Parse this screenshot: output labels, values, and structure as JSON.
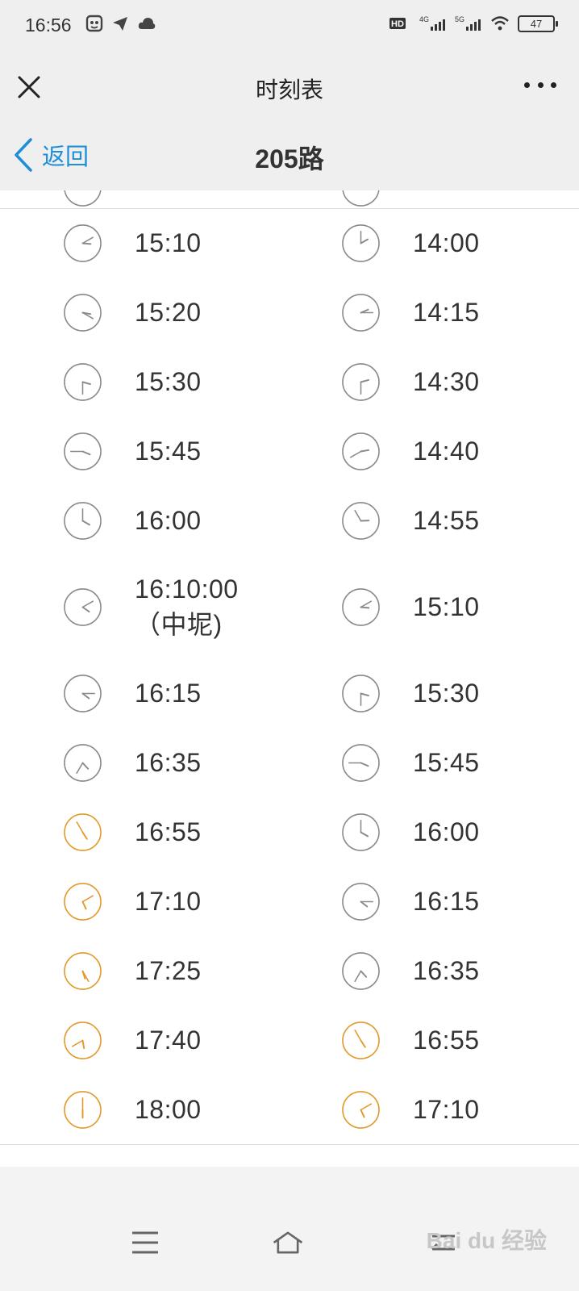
{
  "status_bar": {
    "time": "16:56",
    "network_1": "4G",
    "network_2": "5G",
    "hd_label": "HD",
    "battery": "47"
  },
  "top_bar": {
    "title": "时刻表"
  },
  "nav_bar": {
    "back_label": "返回",
    "route_title": "205路"
  },
  "colors": {
    "accent": "#1d8fd6",
    "clock_gray": "#8a8a8a",
    "clock_orange": "#e39a2b"
  },
  "timetable": {
    "rows": [
      {
        "left": {
          "time": "15:10",
          "sub": "",
          "color": "gray"
        },
        "right": {
          "time": "14:00",
          "color": "gray"
        }
      },
      {
        "left": {
          "time": "15:20",
          "sub": "",
          "color": "gray"
        },
        "right": {
          "time": "14:15",
          "color": "gray"
        }
      },
      {
        "left": {
          "time": "15:30",
          "sub": "",
          "color": "gray"
        },
        "right": {
          "time": "14:30",
          "color": "gray"
        }
      },
      {
        "left": {
          "time": "15:45",
          "sub": "",
          "color": "gray"
        },
        "right": {
          "time": "14:40",
          "color": "gray"
        }
      },
      {
        "left": {
          "time": "16:00",
          "sub": "",
          "color": "gray"
        },
        "right": {
          "time": "14:55",
          "color": "gray"
        }
      },
      {
        "left": {
          "time": "16:10:00",
          "sub": "（中坭)",
          "color": "gray"
        },
        "right": {
          "time": "15:10",
          "color": "gray"
        }
      },
      {
        "left": {
          "time": "16:15",
          "sub": "",
          "color": "gray"
        },
        "right": {
          "time": "15:30",
          "color": "gray"
        }
      },
      {
        "left": {
          "time": "16:35",
          "sub": "",
          "color": "gray"
        },
        "right": {
          "time": "15:45",
          "color": "gray"
        }
      },
      {
        "left": {
          "time": "16:55",
          "sub": "",
          "color": "orange"
        },
        "right": {
          "time": "16:00",
          "color": "gray"
        }
      },
      {
        "left": {
          "time": "17:10",
          "sub": "",
          "color": "orange"
        },
        "right": {
          "time": "16:15",
          "color": "gray"
        }
      },
      {
        "left": {
          "time": "17:25",
          "sub": "",
          "color": "orange"
        },
        "right": {
          "time": "16:35",
          "color": "gray"
        }
      },
      {
        "left": {
          "time": "17:40",
          "sub": "",
          "color": "orange"
        },
        "right": {
          "time": "16:55",
          "color": "orange"
        }
      },
      {
        "left": {
          "time": "18:00",
          "sub": "",
          "color": "orange"
        },
        "right": {
          "time": "17:10",
          "color": "orange"
        }
      }
    ]
  },
  "watermark": "Bai du 经验",
  "icons": {
    "close": "close-icon",
    "more": "more-icon",
    "back": "back-chevron-icon",
    "clock": "clock-icon",
    "menu": "menu-icon",
    "home": "home-icon",
    "recent": "back-nav-icon"
  }
}
